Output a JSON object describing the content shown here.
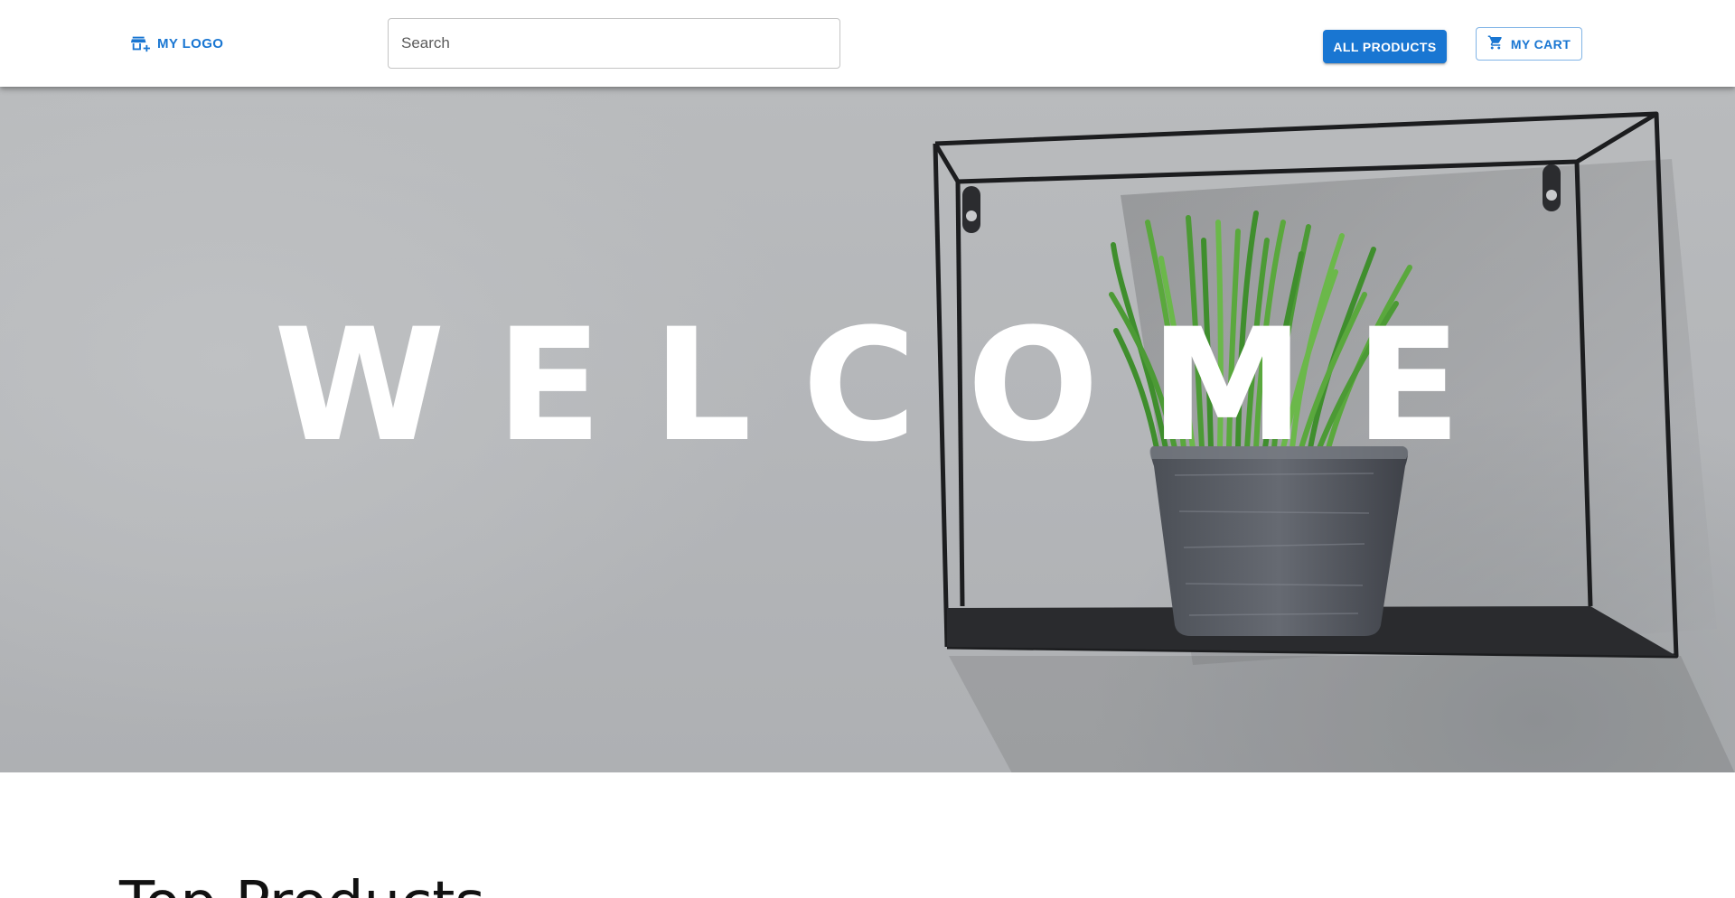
{
  "header": {
    "logo_label": "MY LOGO",
    "logo_icon": "store-add-icon",
    "search": {
      "placeholder": "Search",
      "value": ""
    },
    "all_products_label": "ALL PRODUCTS",
    "cart_label": "MY CART",
    "cart_icon": "shopping-cart-icon"
  },
  "hero": {
    "title": "WELCOME"
  },
  "section": {
    "title": "Top Products"
  },
  "colors": {
    "primary": "#1976d2",
    "hero_text": "#ffffff",
    "wall": "#b7b9bc"
  }
}
